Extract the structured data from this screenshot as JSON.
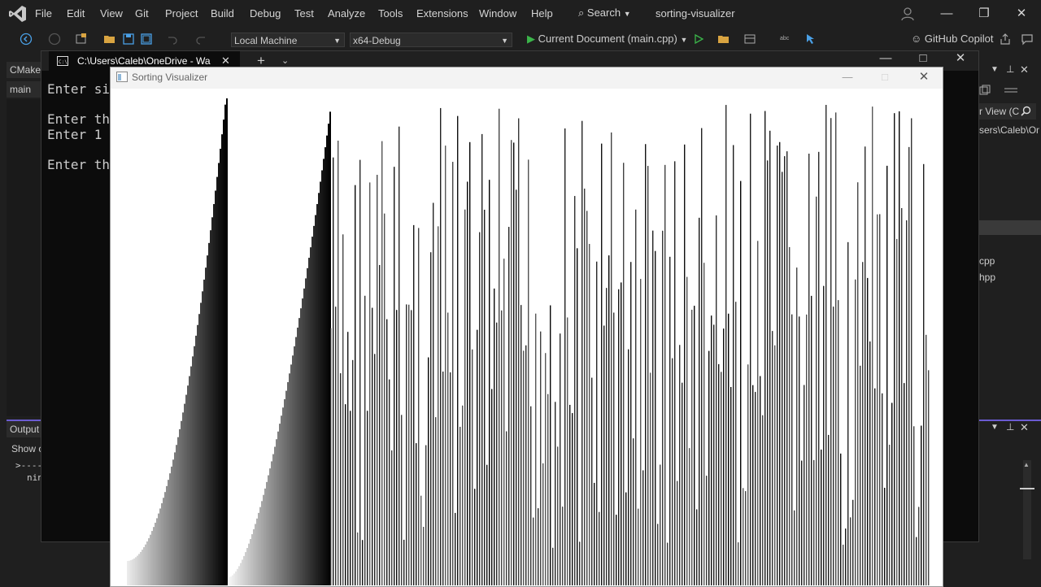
{
  "vs": {
    "menu": [
      "File",
      "Edit",
      "View",
      "Git",
      "Project",
      "Build",
      "Debug",
      "Test",
      "Analyze",
      "Tools",
      "Extensions",
      "Window",
      "Help"
    ],
    "search_label": "Search",
    "project_name": "sorting-visualizer",
    "toolbar": {
      "machine": "Local Machine",
      "config": "x64-Debug",
      "run_target": "Current Document (main.cpp)",
      "copilot": "GitHub Copilot"
    },
    "left": {
      "cmake_tab": "CMake",
      "main_tab": "main",
      "output_tab": "Output",
      "show_output": "Show c",
      "out_line1": ">----",
      "out_line2": "nin"
    },
    "right": {
      "search": "r View (C",
      "path": "sers\\Caleb\\On",
      "file1": "cpp",
      "file2": "hpp"
    }
  },
  "terminal": {
    "tab_title": "C:\\Users\\Caleb\\OneDrive - Wa",
    "lines": [
      "Enter si",
      "",
      "Enter the",
      "Enter 1 ",
      "",
      "Enter the"
    ]
  },
  "visualizer": {
    "title": "Sorting Visualizer"
  }
}
